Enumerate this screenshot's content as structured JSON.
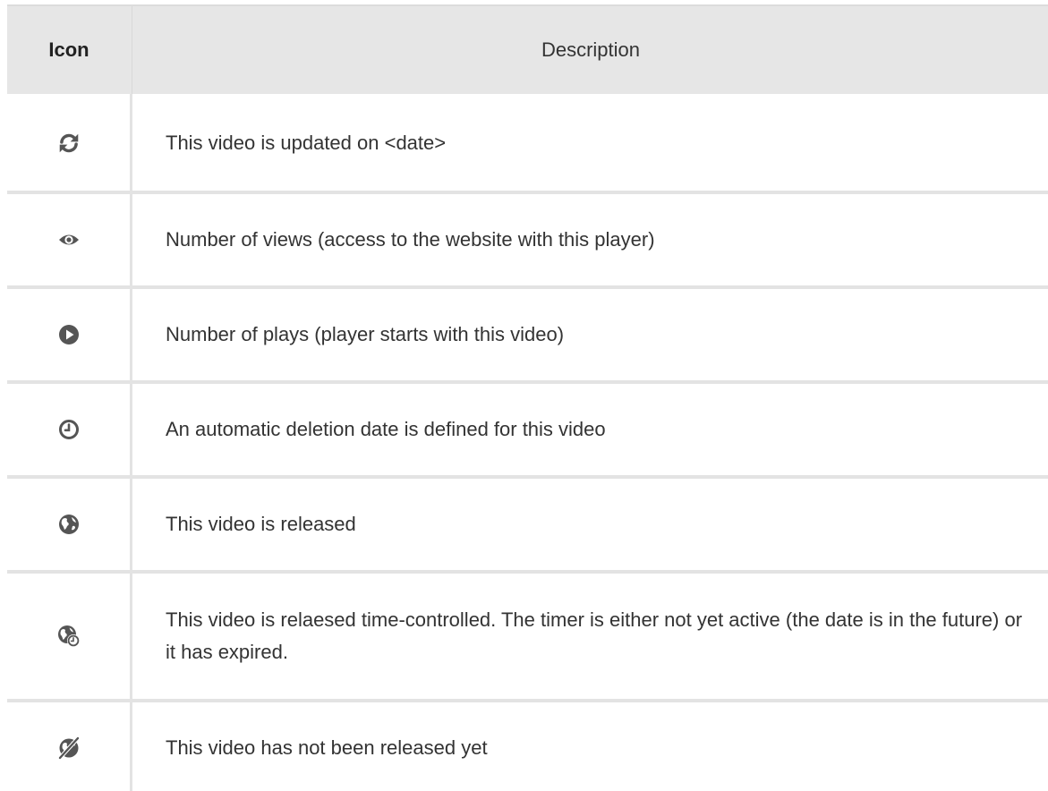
{
  "header": {
    "icon_label": "Icon",
    "description_label": "Description"
  },
  "rows": [
    {
      "icon": "refresh-icon",
      "description": "This video is updated on <date>"
    },
    {
      "icon": "eye-icon",
      "description": "Number of views (access to the website with this player)"
    },
    {
      "icon": "play-circle-icon",
      "description": "Number of plays (player starts with this video)"
    },
    {
      "icon": "clock-icon",
      "description": "An automatic deletion date is defined for this video"
    },
    {
      "icon": "globe-icon",
      "description": "This video is released"
    },
    {
      "icon": "globe-clock-icon",
      "description": "This video is relaesed time-controlled. The timer is either not yet active (the date is in the future) or it has expired."
    },
    {
      "icon": "globe-off-icon",
      "description": "This video has not been released yet"
    }
  ],
  "colors": {
    "header_bg": "#e6e6e6",
    "grid_line": "#e3e3e3",
    "icon": "#555555",
    "text": "#333333"
  }
}
